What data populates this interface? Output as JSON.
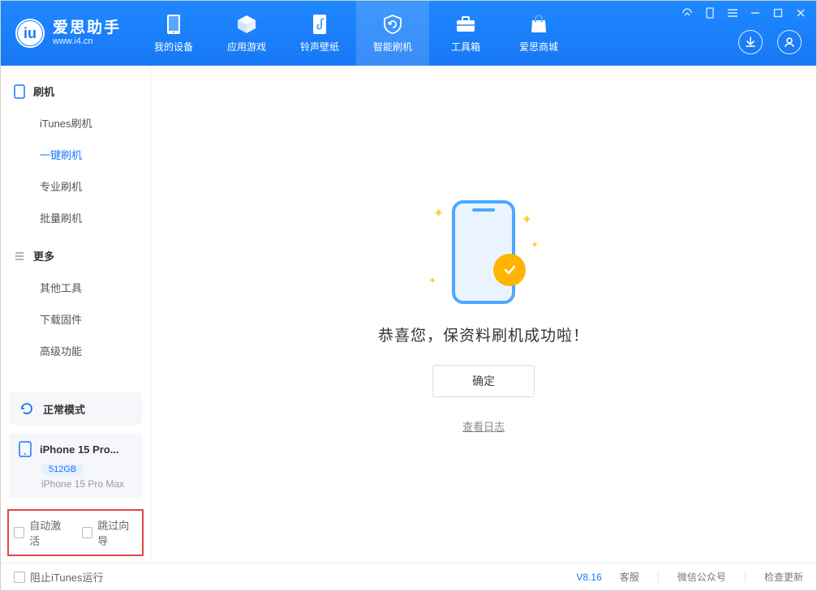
{
  "brand": {
    "name": "爱思助手",
    "url": "www.i4.cn"
  },
  "nav": {
    "items": [
      {
        "label": "我的设备"
      },
      {
        "label": "应用游戏"
      },
      {
        "label": "铃声壁纸"
      },
      {
        "label": "智能刷机"
      },
      {
        "label": "工具箱"
      },
      {
        "label": "爱思商城"
      }
    ],
    "active_index": 3
  },
  "sidebar": {
    "group1_title": "刷机",
    "group1_items": [
      "iTunes刷机",
      "一键刷机",
      "专业刷机",
      "批量刷机"
    ],
    "group1_active_index": 1,
    "group2_title": "更多",
    "group2_items": [
      "其他工具",
      "下载固件",
      "高级功能"
    ]
  },
  "status": {
    "label": "正常模式"
  },
  "device": {
    "name": "iPhone 15 Pro...",
    "capacity": "512GB",
    "full_name": "iPhone 15 Pro Max"
  },
  "activation_options": {
    "auto_activate": "自动激活",
    "skip_wizard": "跳过向导"
  },
  "main": {
    "success_message": "恭喜您，保资料刷机成功啦！",
    "ok_button": "确定",
    "view_log": "查看日志"
  },
  "footer": {
    "block_itunes": "阻止iTunes运行",
    "version": "V8.16",
    "links": [
      "客服",
      "微信公众号",
      "检查更新"
    ]
  }
}
